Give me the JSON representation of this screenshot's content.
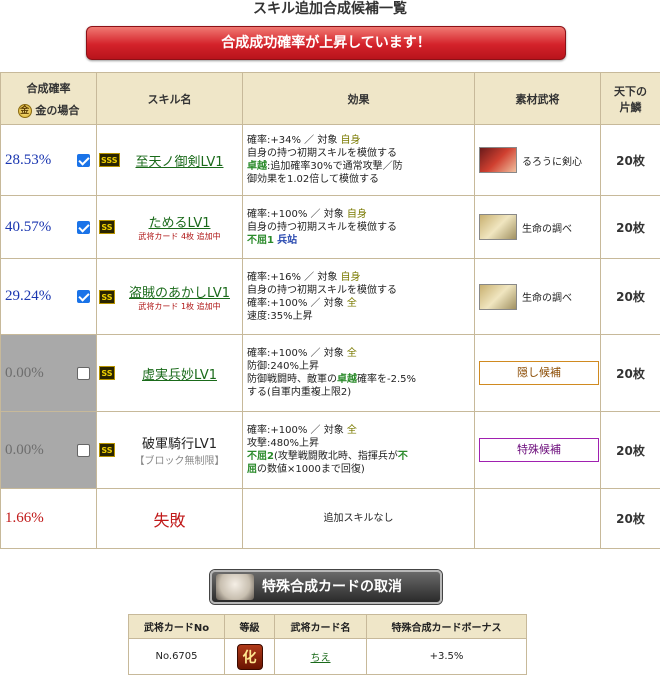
{
  "page_title": "スキル追加合成候補一覧",
  "banner": "合成成功確率が上昇しています！",
  "headers": {
    "rate_line1": "合成確率",
    "rate_line2": "金の場合",
    "gold_icon": "金",
    "skill": "スキル名",
    "effect": "効果",
    "material": "素材武将",
    "cost_line1": "天下の",
    "cost_line2": "片鱗"
  },
  "rows": [
    {
      "rate": "28.53%",
      "checked": true,
      "rank": "SSS",
      "skill_name": "至天ノ御剣LV1",
      "skill_sub": "",
      "effect": [
        "確率:+34%",
        "対象",
        "自身",
        "自身の持つ初期スキルを模倣する",
        "卓越",
        ":追加確率30%で通常攻撃／防",
        "御効果を1.02倍して模倣する"
      ],
      "material": "るろうに剣心",
      "cost": "20枚"
    },
    {
      "rate": "40.57%",
      "checked": true,
      "rank": "SS",
      "skill_name": "ためるLV1",
      "skill_sub": "武将カード 4枚 追加中",
      "effect": [
        "確率:+100%",
        "対象",
        "自身",
        "自身の持つ初期スキルを模倣する",
        "不屈1",
        "兵站"
      ],
      "material": "生命の調べ",
      "cost": "20枚"
    },
    {
      "rate": "29.24%",
      "checked": true,
      "rank": "SS",
      "skill_name": "盗賊のあかしLV1",
      "skill_sub": "武将カード 1枚 追加中",
      "effect": [
        "確率:+16%",
        "対象",
        "自身",
        "自身の持つ初期スキルを模倣する",
        "確率:+100%",
        "対象",
        "全",
        "速度:35%上昇"
      ],
      "material": "生命の調べ",
      "cost": "20枚"
    },
    {
      "rate": "0.00%",
      "checked": false,
      "rank": "SS",
      "skill_name": "虚実兵妙LV1",
      "skill_sub": "",
      "effect": [
        "確率:+100%",
        "対象",
        "全",
        "防御:240%上昇",
        "防御戦闘時、敵軍の",
        "卓越",
        "確率を-2.5%",
        "する(自軍内重複上限2)"
      ],
      "material": "隠し候補",
      "cost": "20枚"
    },
    {
      "rate": "0.00%",
      "checked": false,
      "rank": "SS",
      "skill_name": "破軍騎行LV1",
      "skill_sub": "【ブロック無制限】",
      "effect": [
        "確率:+100%",
        "対象",
        "全",
        "攻撃:480%上昇",
        "不屈2",
        "(攻撃戦闘敗北時、指揮兵が",
        "不",
        "屈",
        "の数値×1000まで回復)"
      ],
      "material": "特殊候補",
      "cost": "20枚"
    },
    {
      "rate": "1.66%",
      "result": "失敗",
      "effect": "追加スキルなし",
      "cost": "20枚"
    }
  ],
  "cancel_button": "特殊合成カードの取消",
  "card_table": {
    "headers": [
      "武将カードNo",
      "等級",
      "武将カード名",
      "特殊合成カードボーナス"
    ],
    "row": {
      "no": "No.6705",
      "grade": "化",
      "name": "ちえ",
      "bonus": "+3.5%"
    }
  }
}
